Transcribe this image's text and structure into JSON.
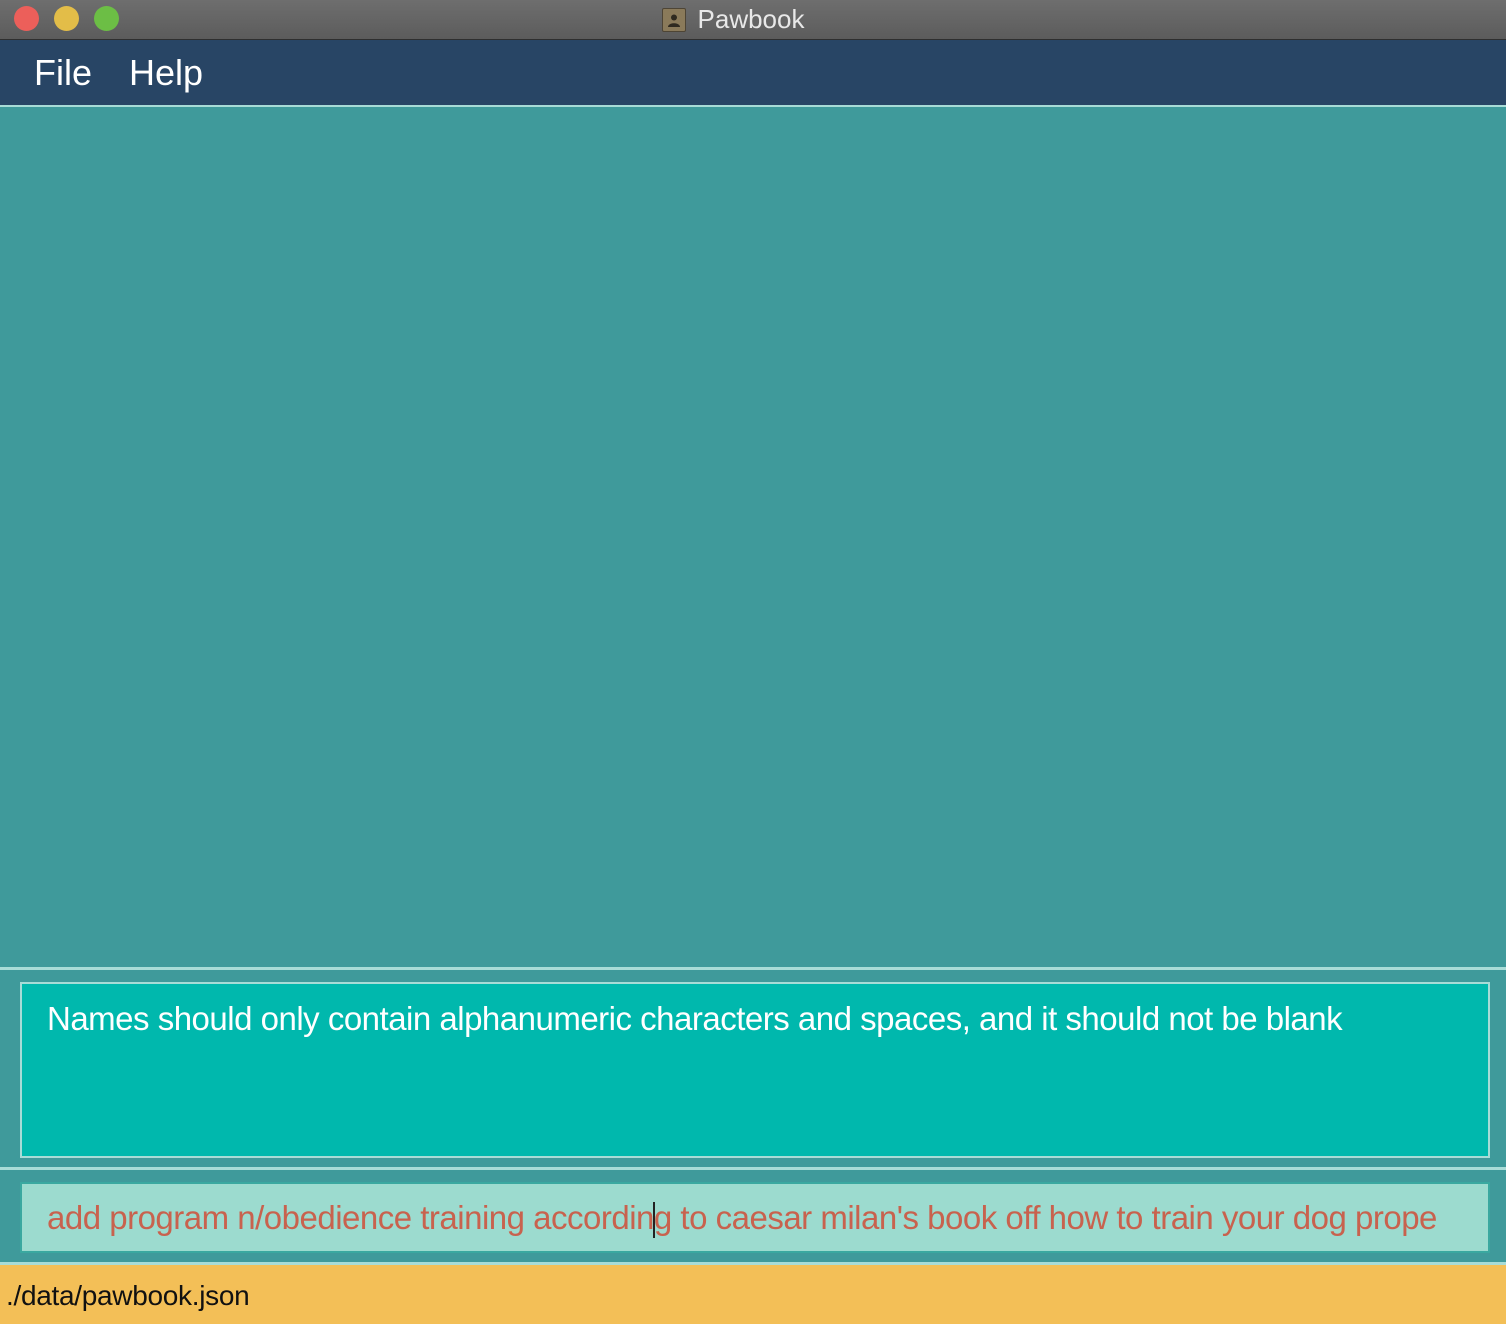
{
  "window": {
    "title": "Pawbook"
  },
  "menu": {
    "items": [
      {
        "label": "File"
      },
      {
        "label": "Help"
      }
    ]
  },
  "result_display": {
    "text": "Names should only contain alphanumeric characters and spaces, and it should not be blank"
  },
  "command_box": {
    "value_before_caret": "add program n/obedience training accordin",
    "value_after_caret": "g to caesar milan's book off how to train your dog prope"
  },
  "status_bar": {
    "file_path": "./data/pawbook.json"
  },
  "colors": {
    "menubar": "#284565",
    "panel": "#3f9a9b",
    "result_bg": "#00b8ad",
    "command_bg": "#9cdbcf",
    "command_text": "#c8624e",
    "statusbar": "#f3bf57"
  },
  "icons": {
    "app": "person-card-icon"
  }
}
